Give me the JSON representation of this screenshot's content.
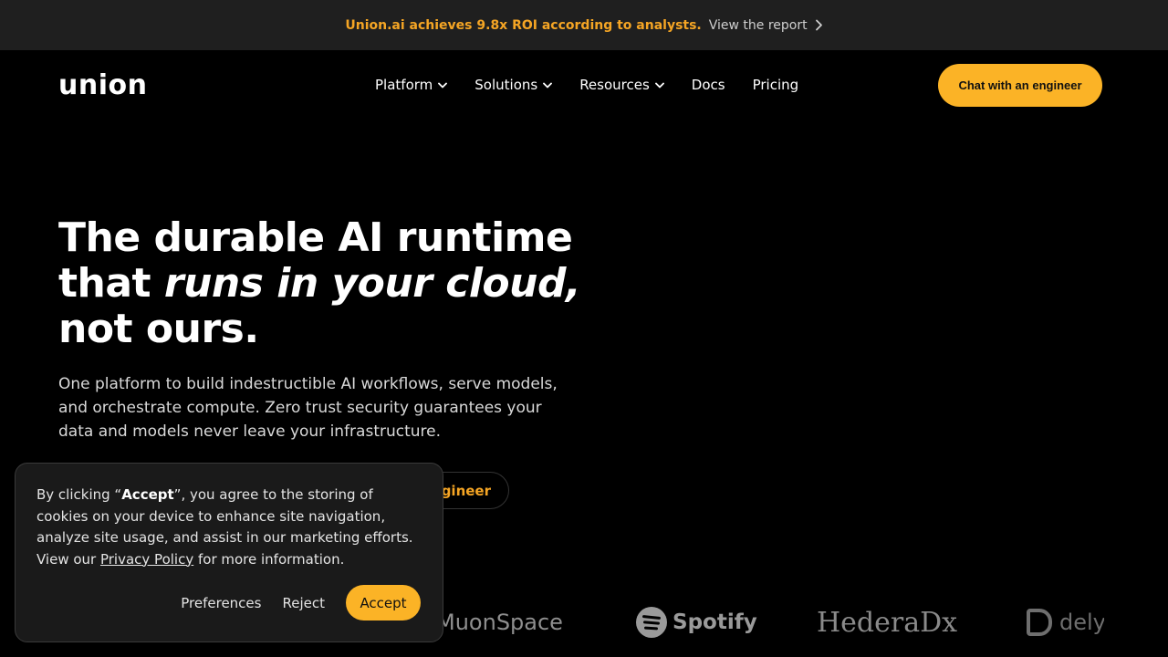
{
  "banner": {
    "highlight": "Union.ai achieves 9.8x ROI according to analysts.",
    "link": "View the report"
  },
  "nav": {
    "logo": "union",
    "items": [
      {
        "label": "Platform",
        "dropdown": true
      },
      {
        "label": "Solutions",
        "dropdown": true
      },
      {
        "label": "Resources",
        "dropdown": true
      },
      {
        "label": "Docs",
        "dropdown": false
      },
      {
        "label": "Pricing",
        "dropdown": false
      }
    ],
    "cta": "Chat with an engineer"
  },
  "hero": {
    "title_line1": "The durable AI runtime",
    "title_line2_prefix": "that ",
    "title_line2_em": "runs in your cloud,",
    "title_line3": "not ours.",
    "subtitle": "One platform to build indestructible AI workflows, serve models, and orchestrate compute. Zero trust security guarantees your data and models never leave your infrastructure.",
    "secondary_cta_visible": "ngineer"
  },
  "logos": {
    "items": [
      "MuonSpace",
      "Spotify",
      "HederaDx",
      "dely"
    ]
  },
  "cookie": {
    "text_prefix": "By clicking “",
    "accept_word": "Accept",
    "text_middle": "”, you agree to the storing of cookies on your device to enhance site navigation, analyze site usage, and assist in our marketing efforts. View our ",
    "privacy_link": "Privacy Policy",
    "text_suffix": " for more information.",
    "preferences": "Preferences",
    "reject": "Reject",
    "accept": "Accept"
  },
  "colors": {
    "accent": "#fbb326",
    "accent_text": "#f5a524",
    "banner_bg": "#1f1f1f",
    "background": "#000000"
  }
}
